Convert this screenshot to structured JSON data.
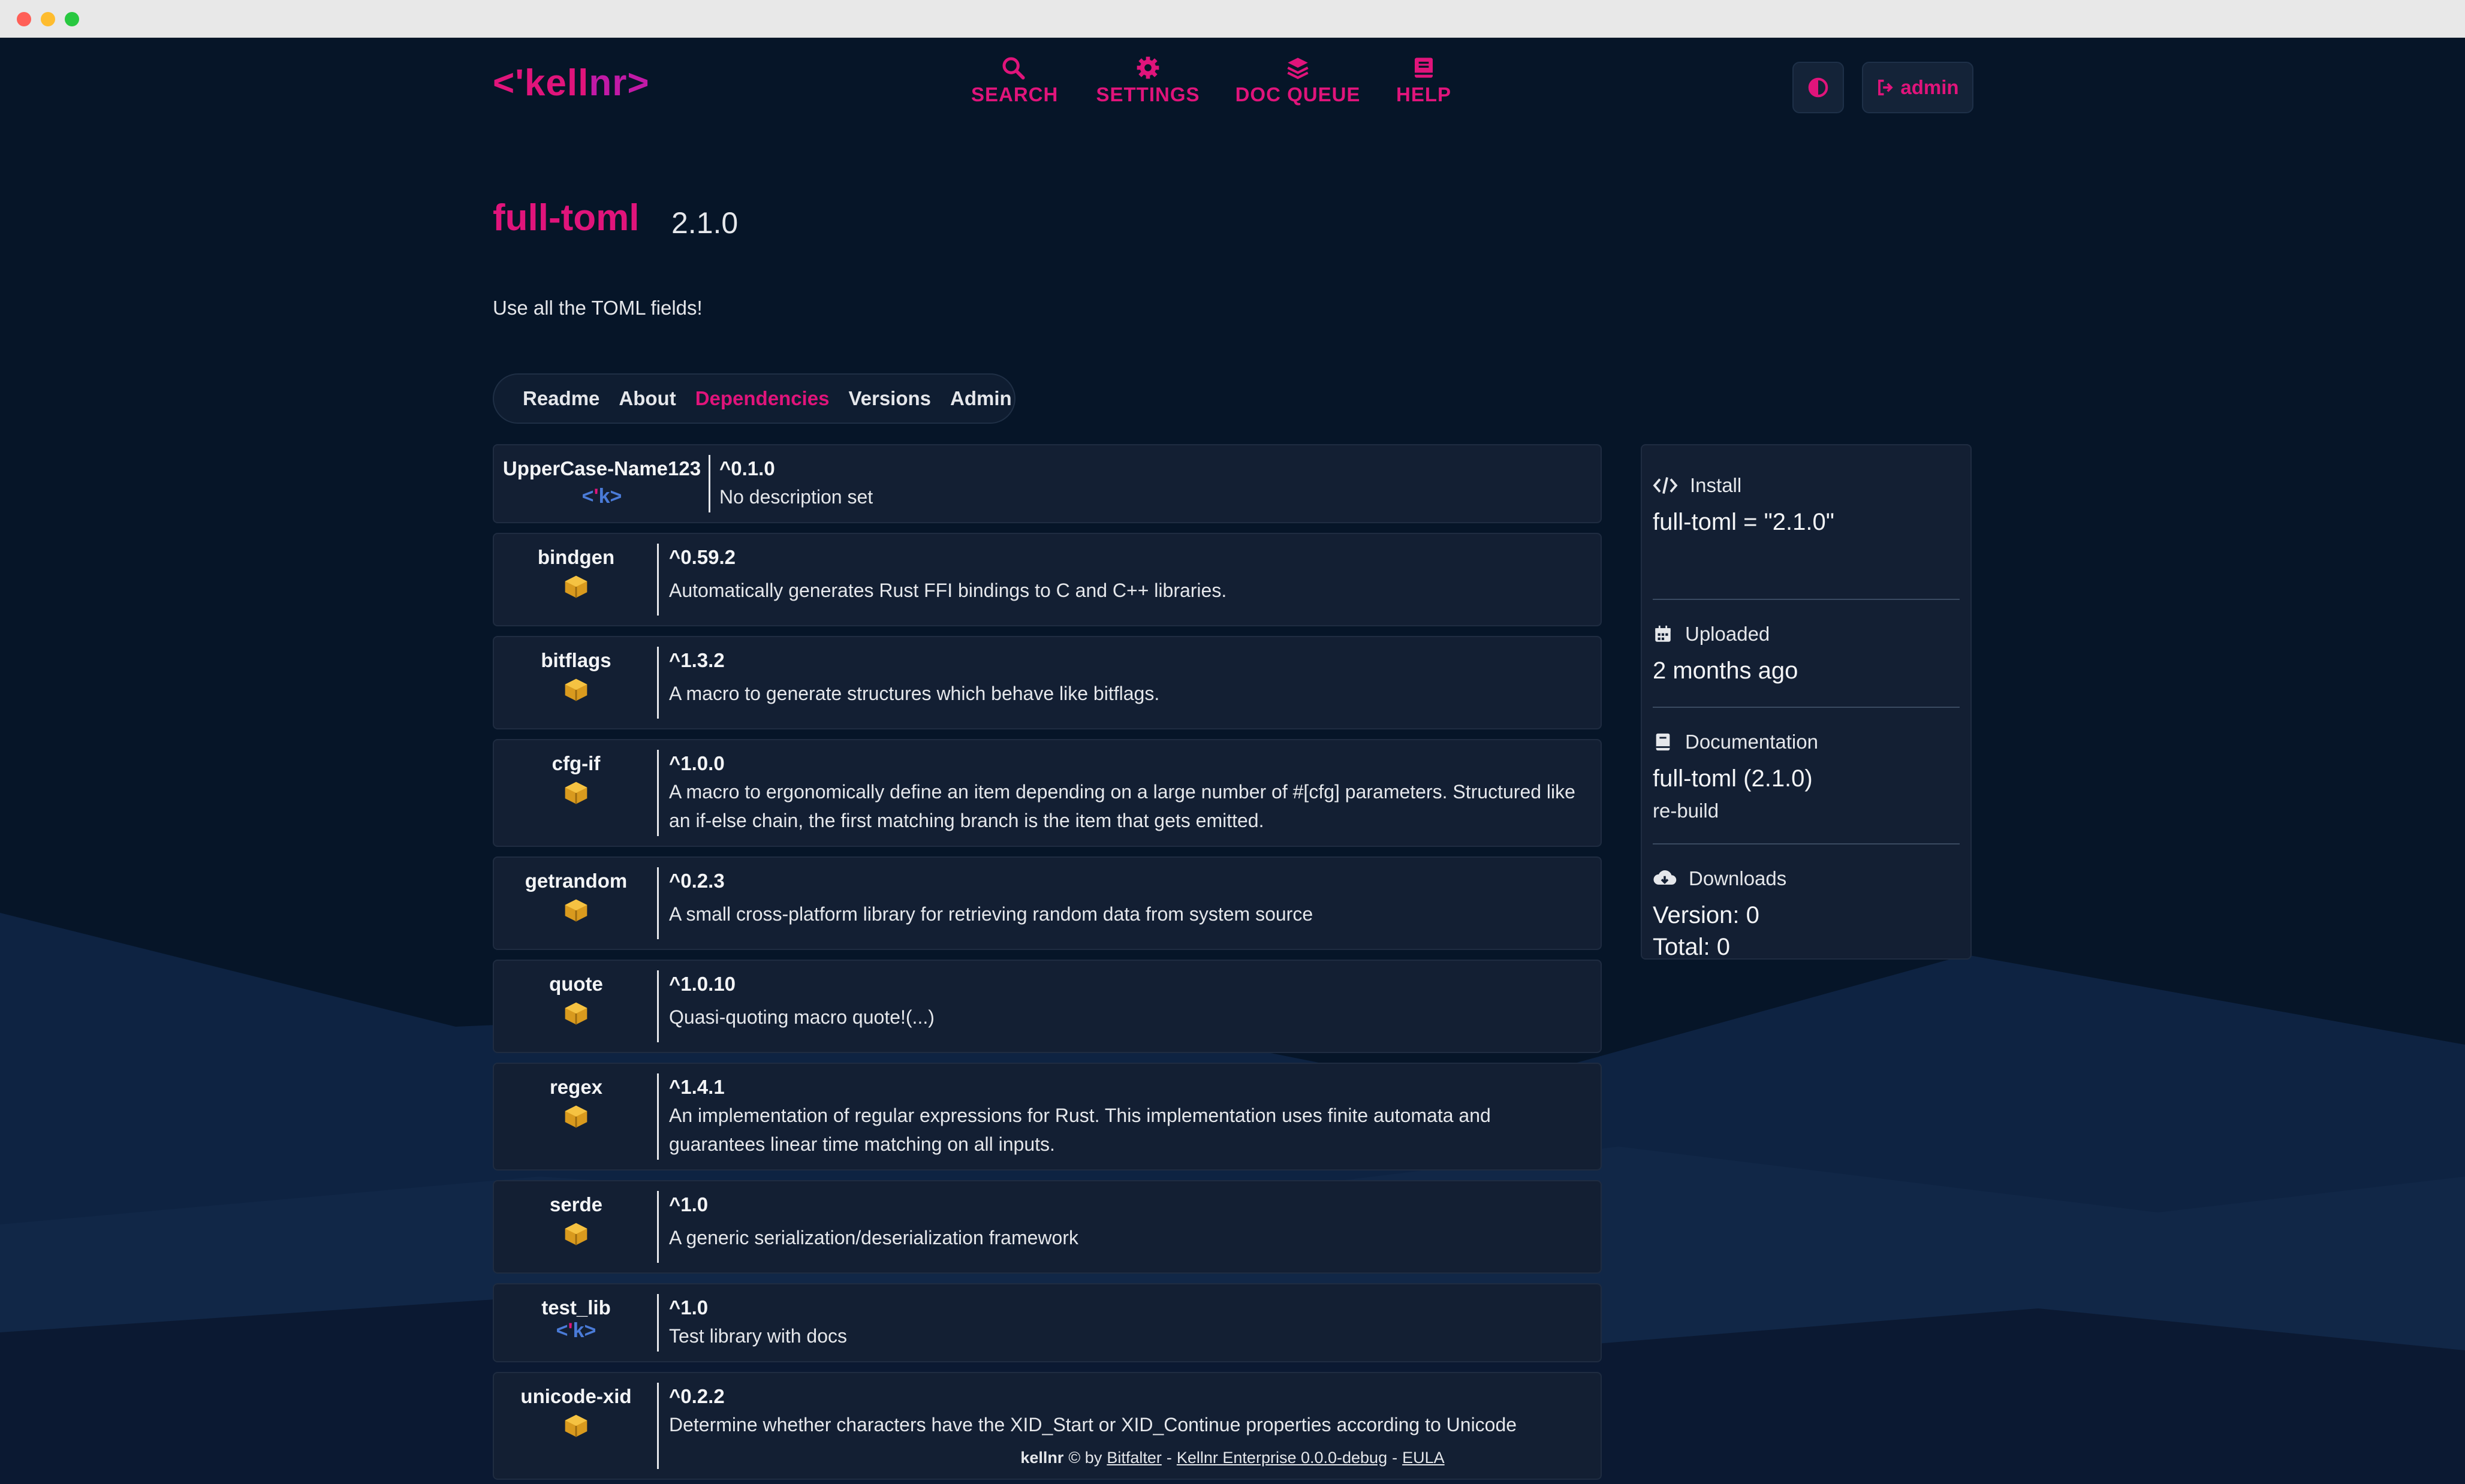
{
  "nav": {
    "logo_part1": "<'kell",
    "logo_part2": "nr>",
    "items": [
      {
        "label": "SEARCH",
        "icon": "search-icon"
      },
      {
        "label": "SETTINGS",
        "icon": "gear-icon"
      },
      {
        "label": "DOC QUEUE",
        "icon": "layers-icon"
      },
      {
        "label": "HELP",
        "icon": "book-icon"
      }
    ],
    "theme_icon": "contrast-icon",
    "admin_label": "admin",
    "admin_icon": "logout-icon"
  },
  "crate": {
    "name": "full-toml",
    "version": "2.1.0",
    "description": "Use all the TOML fields!"
  },
  "tabs": [
    {
      "label": "Readme",
      "active": false
    },
    {
      "label": "About",
      "active": false
    },
    {
      "label": "Dependencies",
      "active": true
    },
    {
      "label": "Versions",
      "active": false
    },
    {
      "label": "Admin",
      "active": false
    }
  ],
  "dependencies": [
    {
      "name": "UpperCase-Name123",
      "icon": "kellnr-icon",
      "version": "^0.1.0",
      "description": "No description set"
    },
    {
      "name": "bindgen",
      "icon": "crate-icon",
      "version": "^0.59.2",
      "description": "Automatically generates Rust FFI bindings to C and C++ libraries."
    },
    {
      "name": "bitflags",
      "icon": "crate-icon",
      "version": "^1.3.2",
      "description": "A macro to generate structures which behave like bitflags."
    },
    {
      "name": "cfg-if",
      "icon": "crate-icon",
      "version": "^1.0.0",
      "description": "A macro to ergonomically define an item depending on a large number of #[cfg] parameters. Structured like an if-else chain, the first matching branch is the item that gets emitted."
    },
    {
      "name": "getrandom",
      "icon": "crate-icon",
      "version": "^0.2.3",
      "description": "A small cross-platform library for retrieving random data from system source"
    },
    {
      "name": "quote",
      "icon": "crate-icon",
      "version": "^1.0.10",
      "description": "Quasi-quoting macro quote!(...)"
    },
    {
      "name": "regex",
      "icon": "crate-icon",
      "version": "^1.4.1",
      "description": "An implementation of regular expressions for Rust. This implementation uses finite automata and guarantees linear time matching on all inputs."
    },
    {
      "name": "serde",
      "icon": "crate-icon",
      "version": "^1.0",
      "description": "A generic serialization/deserialization framework"
    },
    {
      "name": "test_lib",
      "icon": "kellnr-icon",
      "version": "^1.0",
      "description": "Test library with docs"
    },
    {
      "name": "unicode-xid",
      "icon": "crate-icon",
      "version": "^0.2.2",
      "description": "Determine whether characters have the XID_Start or XID_Continue properties according to Unicode"
    }
  ],
  "kellnr_badge": {
    "open": "<",
    "quote": "'",
    "k": "k",
    "close": ">"
  },
  "sidebar": {
    "install": {
      "label": "Install",
      "value": "full-toml = \"2.1.0\""
    },
    "uploaded": {
      "label": "Uploaded",
      "value": "2 months ago"
    },
    "documentation": {
      "label": "Documentation",
      "value": "full-toml (2.1.0)",
      "action": "re-build"
    },
    "downloads": {
      "label": "Downloads",
      "version": "Version: 0",
      "total": "Total: 0"
    }
  },
  "footer": {
    "brand": "kellnr",
    "by_text": "© by",
    "company": "Bitfalter",
    "sep1": "-",
    "edition": "Kellnr Enterprise 0.0.0-debug",
    "sep2": "-",
    "eula": "EULA"
  },
  "colors": {
    "accent": "#e0147b",
    "background": "#061528",
    "card": "#131f33",
    "kellnr_blue": "#4a7bd8"
  }
}
